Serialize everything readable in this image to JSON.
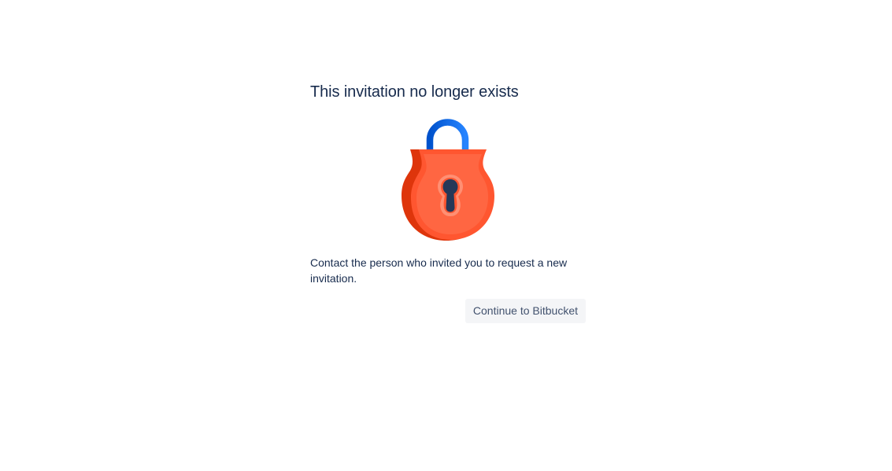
{
  "dialog": {
    "title": "This invitation no longer exists",
    "message": "Contact the person who invited you to request a new invitation.",
    "continue_button_label": "Continue to Bitbucket"
  },
  "illustration": {
    "icon": "padlock-icon",
    "shackle_color": "#2684FF",
    "body_color": "#FF5630",
    "keyhole_color": "#253858"
  }
}
